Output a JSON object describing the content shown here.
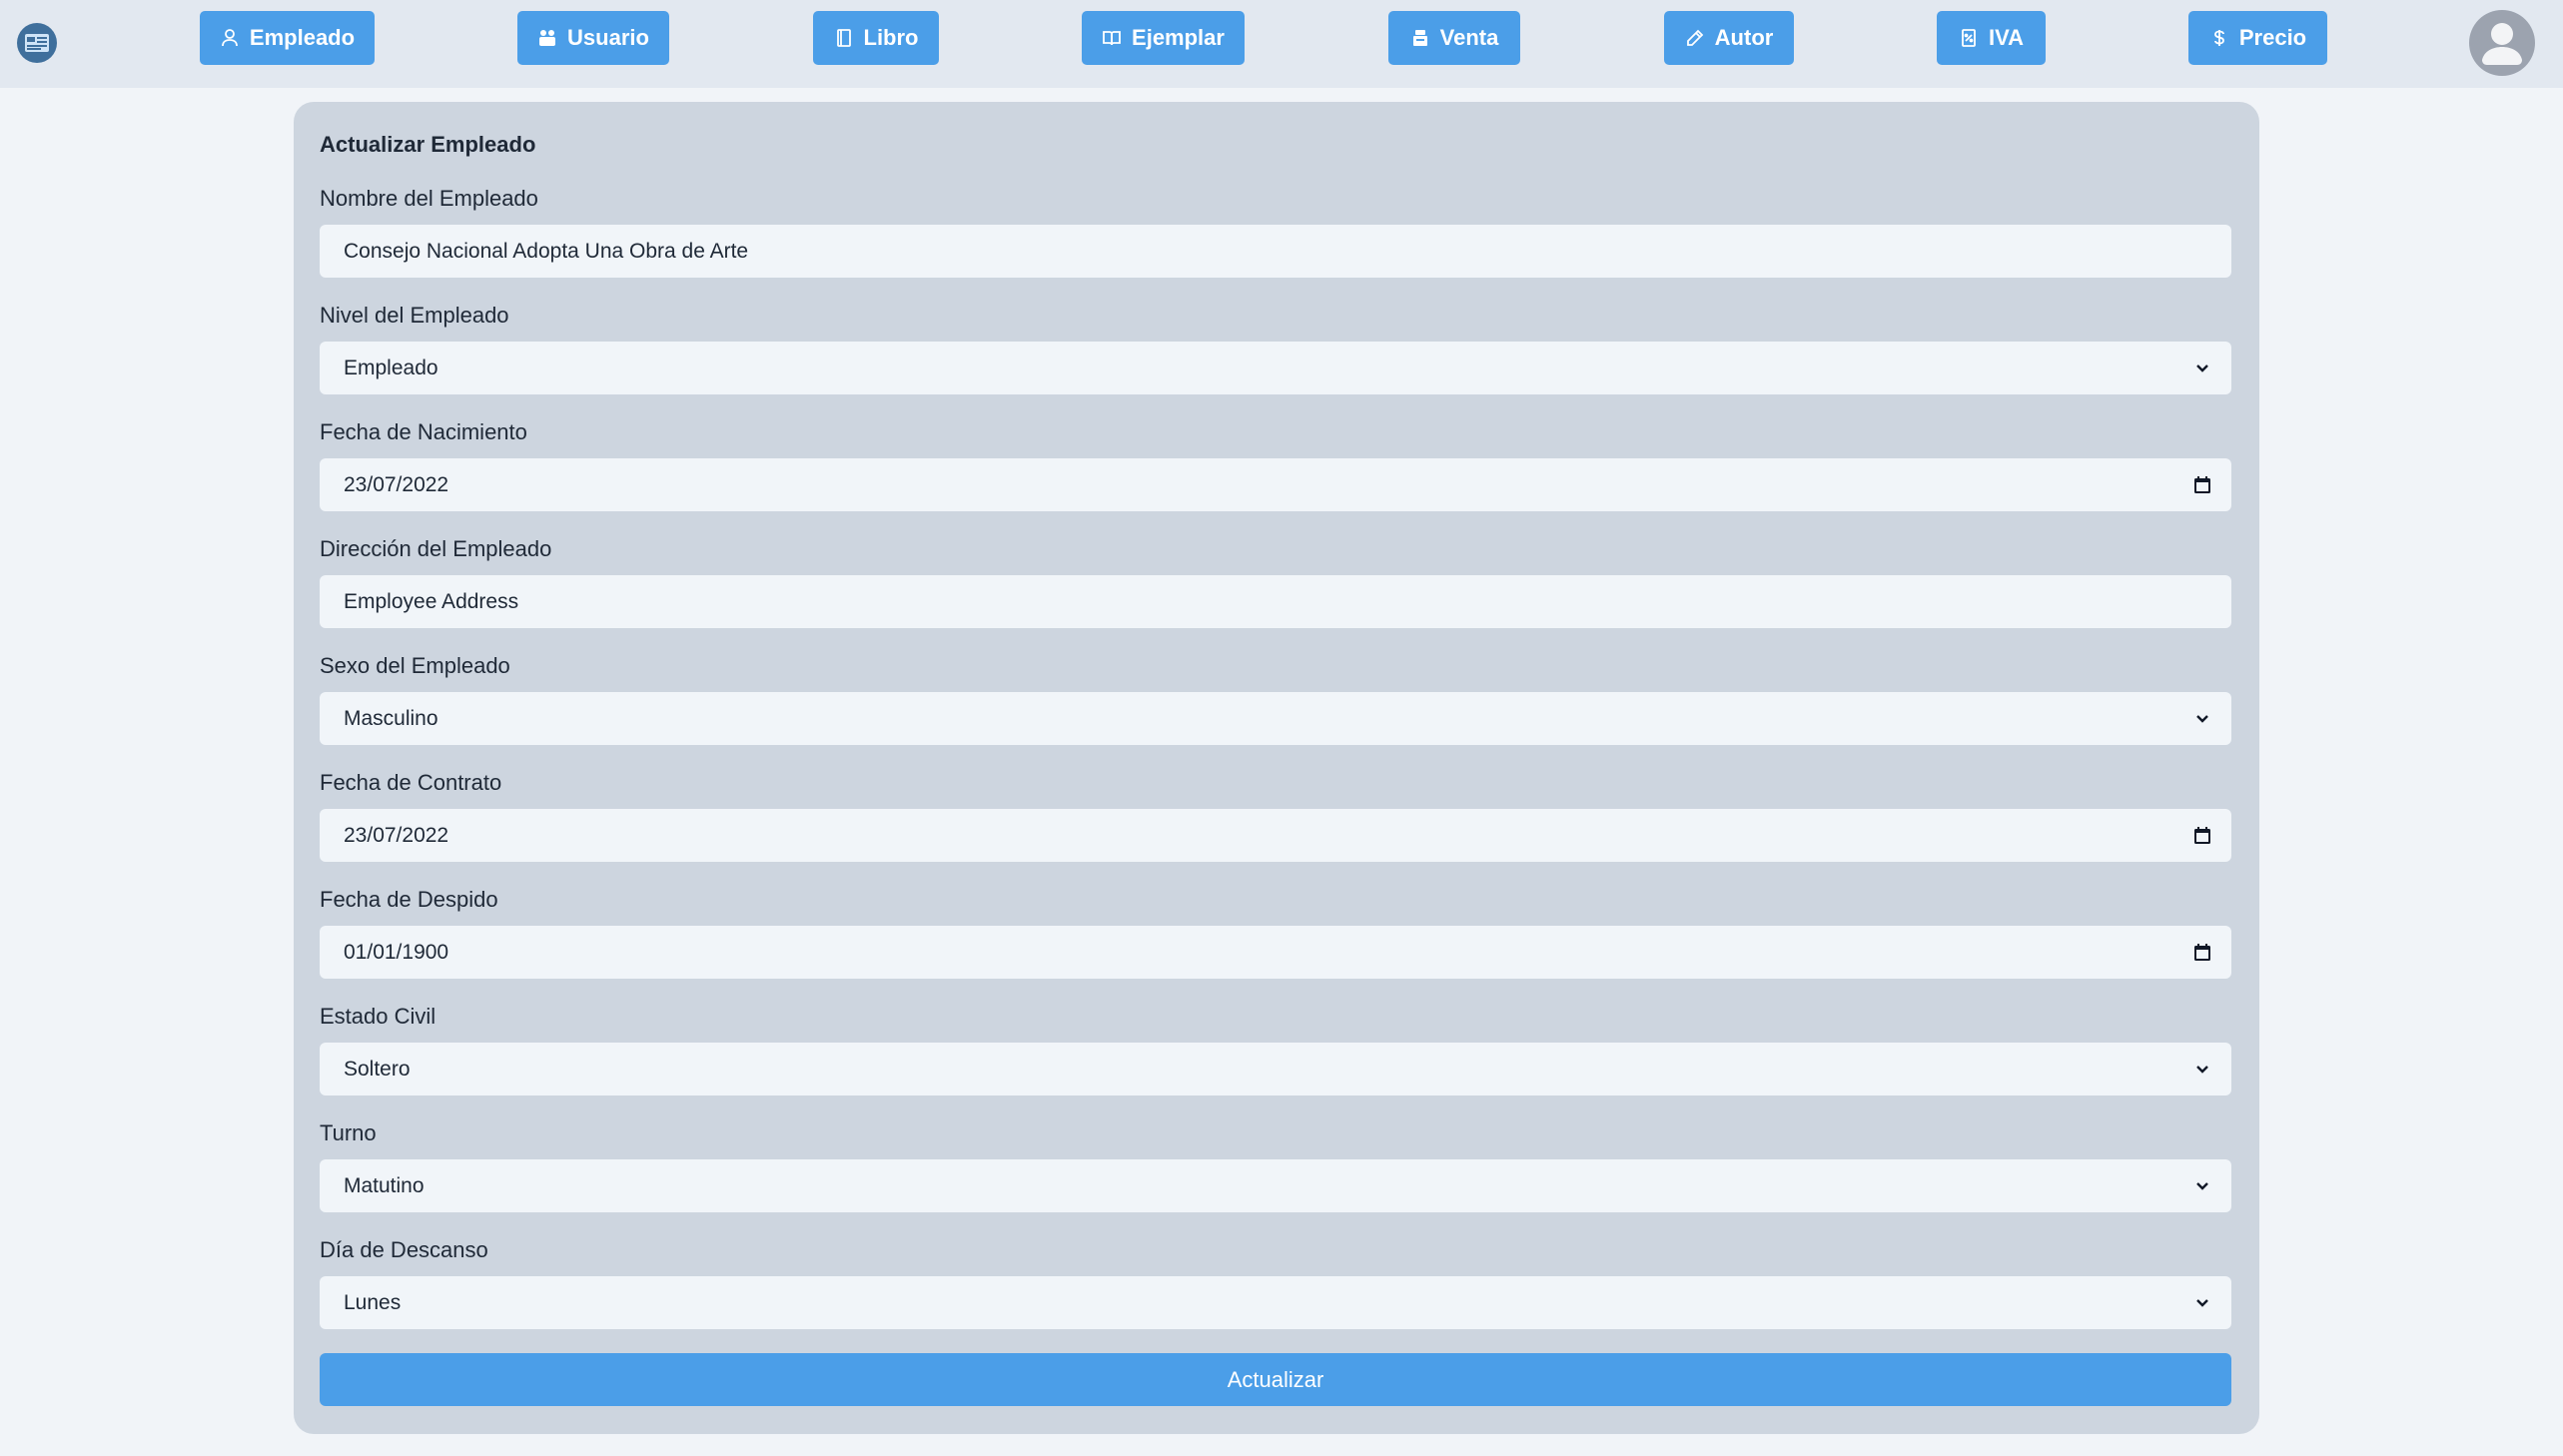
{
  "nav": {
    "logo_icon": "app-logo-icon",
    "buttons": [
      {
        "label": "Empleado",
        "icon": "user-icon"
      },
      {
        "label": "Usuario",
        "icon": "users-icon"
      },
      {
        "label": "Libro",
        "icon": "book-icon"
      },
      {
        "label": "Ejemplar",
        "icon": "open-book-icon"
      },
      {
        "label": "Venta",
        "icon": "cash-register-icon"
      },
      {
        "label": "Autor",
        "icon": "pencil-icon"
      },
      {
        "label": "IVA",
        "icon": "receipt-icon"
      },
      {
        "label": "Precio",
        "icon": "dollar-icon"
      }
    ],
    "avatar_icon": "user-avatar-icon"
  },
  "form": {
    "title": "Actualizar Empleado",
    "fields": {
      "nombre": {
        "label": "Nombre del Empleado",
        "value": "Consejo Nacional Adopta Una Obra de Arte"
      },
      "nivel": {
        "label": "Nivel del Empleado",
        "value": "Empleado"
      },
      "nacimiento": {
        "label": "Fecha de Nacimiento",
        "value": "23/07/2022"
      },
      "direccion": {
        "label": "Dirección del Empleado",
        "value": "Employee Address"
      },
      "sexo": {
        "label": "Sexo del Empleado",
        "value": "Masculino"
      },
      "contrato": {
        "label": "Fecha de Contrato",
        "value": "23/07/2022"
      },
      "despido": {
        "label": "Fecha de Despido",
        "value": "01/01/1900"
      },
      "estado_civil": {
        "label": "Estado Civil",
        "value": "Soltero"
      },
      "turno": {
        "label": "Turno",
        "value": "Matutino"
      },
      "descanso": {
        "label": "Día de Descanso",
        "value": "Lunes"
      }
    },
    "submit_label": "Actualizar"
  },
  "colors": {
    "accent": "#4b9ee8",
    "topbar": "#e2e8f0",
    "card": "#cdd5df",
    "input": "#f1f5f9",
    "page": "#f1f4f8"
  }
}
